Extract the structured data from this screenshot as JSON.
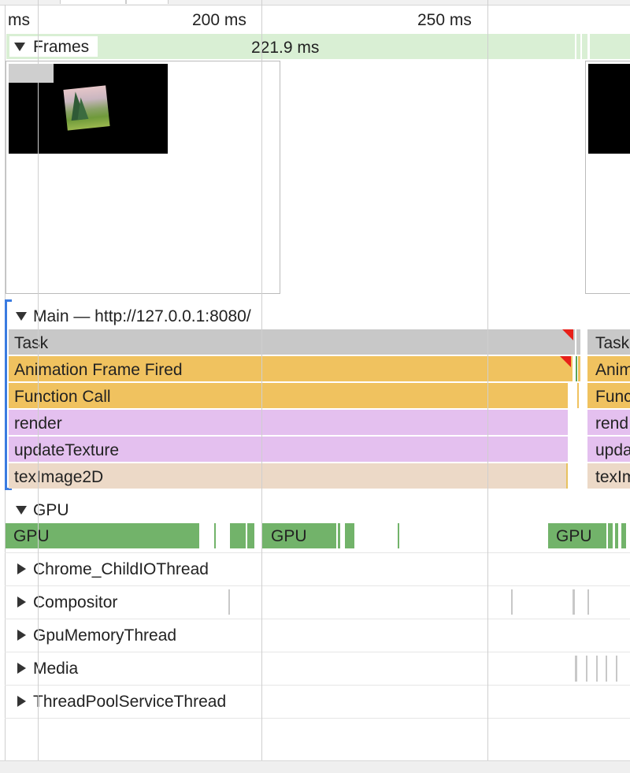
{
  "ruler": {
    "labels": [
      "ms",
      "200 ms",
      "250 ms"
    ]
  },
  "frames": {
    "label": "Frames",
    "duration": "221.9 ms"
  },
  "main": {
    "title": "Main — http://127.0.0.1:8080/",
    "entries": [
      {
        "label": "Task",
        "continued": "Task"
      },
      {
        "label": "Animation Frame Fired",
        "continued": "Anim"
      },
      {
        "label": "Function Call",
        "continued": "Func"
      },
      {
        "label": "render",
        "continued": "rend"
      },
      {
        "label": "updateTexture",
        "continued": "upda"
      },
      {
        "label": "texImage2D",
        "continued": "texIm"
      }
    ],
    "colors": {
      "task": "#c8c8c8",
      "scripting": "#f0c25f",
      "js": "#e4c0ef",
      "gpu_call": "#ecd9c7"
    }
  },
  "gpu": {
    "label": "GPU",
    "blocks": [
      "GPU",
      "GPU",
      "GPU"
    ],
    "color": "#72b36a"
  },
  "threads": [
    {
      "label": "Chrome_ChildIOThread"
    },
    {
      "label": "Compositor"
    },
    {
      "label": "GpuMemoryThread"
    },
    {
      "label": "Media"
    },
    {
      "label": "ThreadPoolServiceThread"
    }
  ]
}
